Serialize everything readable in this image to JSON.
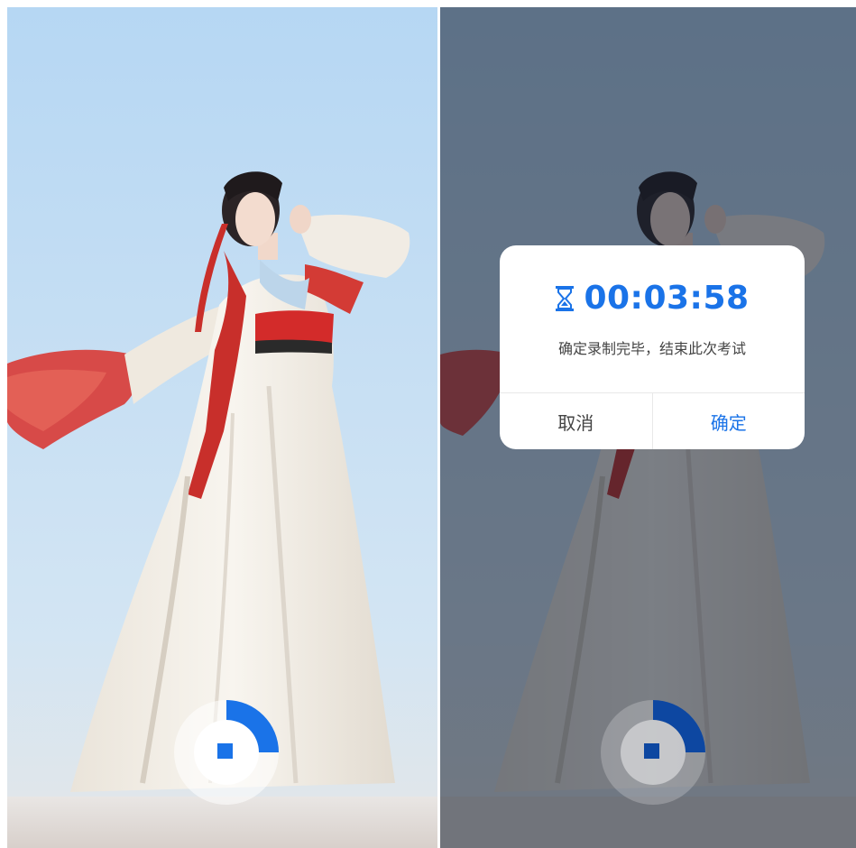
{
  "recording": {
    "progress_fraction": 0.25,
    "accent_color": "#1a73e8"
  },
  "dialog": {
    "timer": "00:03:58",
    "timer_icon": "hourglass-icon",
    "message": "确定录制完毕，结束此次考试",
    "cancel_label": "取消",
    "confirm_label": "确定"
  },
  "colors": {
    "sky_top": "#b9daf3",
    "sky_bottom": "#d9e8f2",
    "accent": "#1a73e8",
    "dress_red": "#d83a35"
  }
}
